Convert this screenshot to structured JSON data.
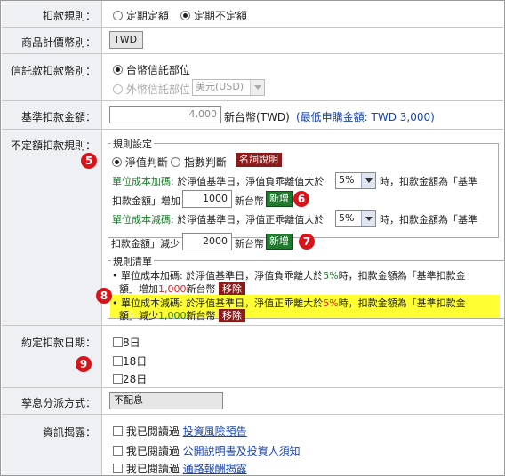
{
  "rows": {
    "method": {
      "label": "扣款規則：",
      "opt1": "定期定額",
      "opt2": "定期不定額"
    },
    "currency": {
      "label": "商品計價幣別：",
      "value": "TWD"
    },
    "account": {
      "label": "信託款扣款幣別：",
      "opt1": "台幣信託部位",
      "opt2": "外幣信託部位",
      "select": "美元(USD)"
    },
    "base": {
      "label": "基準扣款金額：",
      "value": "4,000",
      "unit": "新台幣(TWD)",
      "note": "(最低申購金額: TWD 3,000)"
    },
    "rules": {
      "label": "不定額扣款規則：",
      "settings_legend": "規則設定",
      "radio1": "淨值判斷",
      "radio2": "指數判斷",
      "explain_btn": "名詞說明",
      "add_title": "單位成本加碼:",
      "add_text": "於淨值基準日，淨值負乖離值大於",
      "add_pct": "5%",
      "add_tail": "時，扣款金額為「基準",
      "add_line2": "扣款金額」增加",
      "add_amount": "1000",
      "add_unit": "新台幣",
      "sub_title": "單位成本減碼:",
      "sub_text": "於淨值基準日，淨值正乖離值大於",
      "sub_pct": "5%",
      "sub_tail": "時，扣款金額為「基準",
      "sub_line2": "扣款金額」減少",
      "sub_amount": "2000",
      "sub_unit": "新台幣",
      "add_btn": "新增",
      "list_legend": "規則清單",
      "item1_a": "• 單位成本加碼: 於淨值基準日，淨值負乖離大於",
      "item1_pct": "5%",
      "item1_b": "時，扣款金額為「基準扣款金",
      "item1_c": "額」增加",
      "item1_amt": "1,000",
      "item1_d": "新台幣",
      "item2_a": "• 單位成本減碼: 於淨值基準日，淨值正乖離大於",
      "item2_pct": "5%",
      "item2_b": "時，扣款金額為「基準扣款金",
      "item2_c": "額」減少",
      "item2_amt": "1,000",
      "item2_d": "新台幣",
      "remove_btn": "移除"
    },
    "dates": {
      "label": "約定扣款日期：",
      "d1": "8日",
      "d2": "18日",
      "d3": "28日"
    },
    "dividend": {
      "label": "孳息分派方式：",
      "value": "不配息"
    },
    "disclosure": {
      "label": "資訊揭露：",
      "prefix": "我已閱讀過",
      "link1": "投資風險預告",
      "link2": "公開說明書及投資人須知",
      "link3": "通路報酬揭露"
    }
  },
  "markers": {
    "m5": "5",
    "m6": "6",
    "m7": "7",
    "m8": "8",
    "m9": "9"
  },
  "colors": {
    "label_bg": "#eef0f3",
    "marker": "#d8141b",
    "highlight": "#ffff33",
    "add_green": "#1f7a2e",
    "remove_red": "#8b1a1a",
    "link_blue": "#1a44a8"
  }
}
